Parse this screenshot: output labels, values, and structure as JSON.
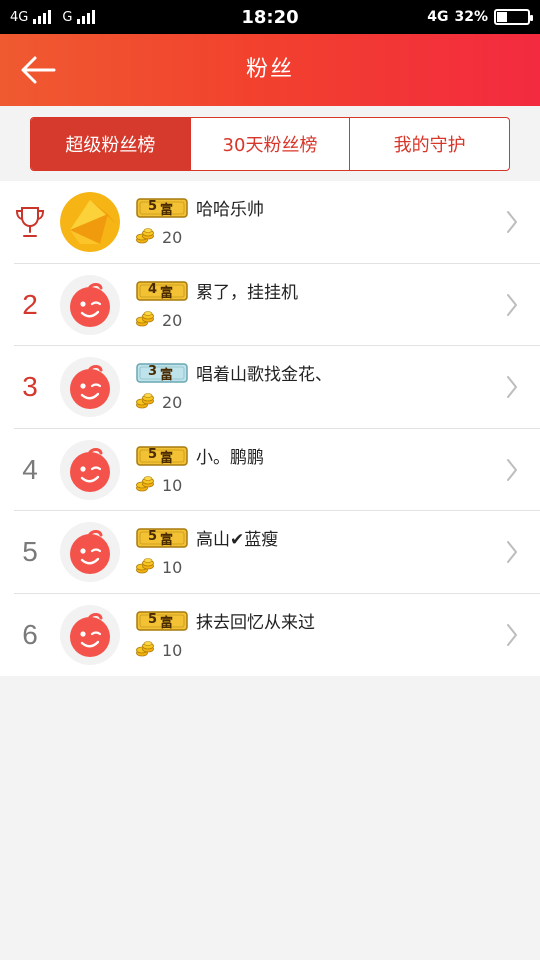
{
  "status_bar": {
    "network1": "4G",
    "network2": "G",
    "time": "18:20",
    "network3": "4G",
    "battery_percent": "32%",
    "battery_level": 0.32
  },
  "header": {
    "title": "粉丝",
    "back_icon": "arrow-left-icon"
  },
  "tabs": [
    {
      "label": "超级粉丝榜",
      "active": true
    },
    {
      "label": "30天粉丝榜",
      "active": false
    },
    {
      "label": "我的守护",
      "active": false
    }
  ],
  "fans": [
    {
      "rank": "",
      "rank_icon": "trophy-icon",
      "avatar": "gold-avatar",
      "level": "5",
      "level_text": "富",
      "name": "哈哈乐帅",
      "count": "20"
    },
    {
      "rank": "2",
      "avatar": "wink-face-avatar",
      "level": "4",
      "level_text": "富",
      "name": "累了，挂挂机",
      "count": "20"
    },
    {
      "rank": "3",
      "avatar": "wink-face-avatar",
      "level": "3",
      "level_text": "富",
      "name": "唱着山歌找金花、",
      "count": "20"
    },
    {
      "rank": "4",
      "avatar": "wink-face-avatar",
      "level": "5",
      "level_text": "富",
      "name": "小。鹏鹏",
      "count": "10"
    },
    {
      "rank": "5",
      "avatar": "wink-face-avatar",
      "level": "5",
      "level_text": "富",
      "name": "高山✔蓝瘦",
      "count": "10"
    },
    {
      "rank": "6",
      "avatar": "wink-face-avatar",
      "level": "5",
      "level_text": "富",
      "name": "抹去回忆从来过",
      "count": "10"
    }
  ],
  "colors": {
    "accent": "#d53a2c",
    "header_start": "#ef5a30",
    "header_end": "#f32a40",
    "badge_gold": "#f2c234",
    "badge_blue": "#bfe3ea"
  }
}
